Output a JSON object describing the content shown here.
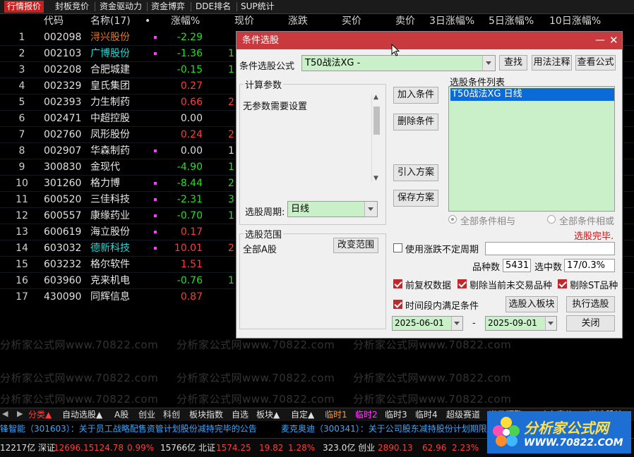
{
  "top_tabs": [
    "行情报价",
    "封板竞价",
    "资金驱动力",
    "资金博弈",
    "DDE排名",
    "SUP统计"
  ],
  "columns": [
    "代码",
    "名称(17)",
    "•",
    "涨幅%",
    "现价",
    "涨跌",
    "买价",
    "卖价",
    "3日涨幅%",
    "5日涨幅%",
    "10日涨幅%"
  ],
  "rows": [
    {
      "idx": "1",
      "code": "002098",
      "name": "浔兴股份",
      "chg": "-2.29",
      "name_color": "#e07a2a",
      "chg_color": "#22e022",
      "dot": true,
      "px": "",
      "px_color": "#22e022"
    },
    {
      "idx": "2",
      "code": "002103",
      "name": "广博股份",
      "chg": "-1.36",
      "name_color": "#28d8d8",
      "chg_color": "#22e022",
      "dot": true,
      "px": "1",
      "px_color": "#22e022"
    },
    {
      "idx": "3",
      "code": "002208",
      "name": "合肥城建",
      "chg": "-0.15",
      "name_color": "#e6e6e6",
      "chg_color": "#22e022",
      "dot": false,
      "px": "1",
      "px_color": "#22e022"
    },
    {
      "idx": "4",
      "code": "002329",
      "name": "皇氏集团",
      "chg": "0.27",
      "name_color": "#e6e6e6",
      "chg_color": "#ff3b3b",
      "dot": false,
      "px": "",
      "px_color": "#ff3b3b"
    },
    {
      "idx": "5",
      "code": "002393",
      "name": "力生制药",
      "chg": "0.66",
      "name_color": "#e6e6e6",
      "chg_color": "#ff3b3b",
      "dot": false,
      "px": "2",
      "px_color": "#ff3b3b"
    },
    {
      "idx": "6",
      "code": "002471",
      "name": "中超控股",
      "chg": "0.00",
      "name_color": "#e6e6e6",
      "chg_color": "#dddddd",
      "dot": false,
      "px": "",
      "px_color": "#dddddd"
    },
    {
      "idx": "7",
      "code": "002760",
      "name": "凤形股份",
      "chg": "0.24",
      "name_color": "#e6e6e6",
      "chg_color": "#ff3b3b",
      "dot": false,
      "px": "2",
      "px_color": "#ff3b3b"
    },
    {
      "idx": "8",
      "code": "002907",
      "name": "华森制药",
      "chg": "0.00",
      "name_color": "#e6e6e6",
      "chg_color": "#dddddd",
      "dot": true,
      "px": "1",
      "px_color": "#dddddd"
    },
    {
      "idx": "9",
      "code": "300830",
      "name": "金现代",
      "chg": "-4.90",
      "name_color": "#e6e6e6",
      "chg_color": "#22e022",
      "dot": false,
      "px": "1",
      "px_color": "#22e022"
    },
    {
      "idx": "10",
      "code": "301260",
      "name": "格力博",
      "chg": "-8.44",
      "name_color": "#e6e6e6",
      "chg_color": "#22e022",
      "dot": true,
      "px": "2",
      "px_color": "#22e022"
    },
    {
      "idx": "11",
      "code": "600520",
      "name": "三佳科技",
      "chg": "-2.31",
      "name_color": "#e6e6e6",
      "chg_color": "#22e022",
      "dot": true,
      "px": "3",
      "px_color": "#22e022"
    },
    {
      "idx": "12",
      "code": "600557",
      "name": "康缘药业",
      "chg": "-0.70",
      "name_color": "#e6e6e6",
      "chg_color": "#22e022",
      "dot": true,
      "px": "1",
      "px_color": "#22e022"
    },
    {
      "idx": "13",
      "code": "600619",
      "name": "海立股份",
      "chg": "0.17",
      "name_color": "#e6e6e6",
      "chg_color": "#ff3b3b",
      "dot": true,
      "px": "",
      "px_color": "#ff3b3b"
    },
    {
      "idx": "14",
      "code": "603032",
      "name": "德新科技",
      "chg": "10.01",
      "name_color": "#28d8d8",
      "chg_color": "#ff3b3b",
      "dot": true,
      "px": "2",
      "px_color": "#ff3b3b"
    },
    {
      "idx": "15",
      "code": "603232",
      "name": "格尔软件",
      "chg": "1.51",
      "name_color": "#e6e6e6",
      "chg_color": "#ff3b3b",
      "dot": false,
      "px": "",
      "px_color": "#ff3b3b"
    },
    {
      "idx": "16",
      "code": "603960",
      "name": "克来机电",
      "chg": "-0.76",
      "name_color": "#e6e6e6",
      "chg_color": "#22e022",
      "dot": false,
      "px": "1",
      "px_color": "#22e022"
    },
    {
      "idx": "17",
      "code": "430090",
      "name": "同辉信息",
      "chg": "0.87",
      "name_color": "#e6e6e6",
      "chg_color": "#ff3b3b",
      "dot": false,
      "px": "",
      "px_color": "#ff3b3b"
    }
  ],
  "watermark": "分析家公式网www.70822.com",
  "dialog": {
    "title": "条件选股",
    "formula_label": "条件选股公式",
    "formula_value": "T50战法XG  -",
    "btn_find": "查找",
    "btn_usage": "用法注释",
    "btn_view": "查看公式",
    "params_title": "计算参数",
    "params_text": "无参数需要设置",
    "btn_add": "加入条件",
    "btn_del": "删除条件",
    "btn_import": "引入方案",
    "btn_save": "保存方案",
    "cond_list_title": "选股条件列表",
    "cond_items": [
      "T50战法XG  日线"
    ],
    "radio_and": "全部条件相与",
    "radio_or": "全部条件相或",
    "status": "选股完毕.",
    "period_label": "选股周期:",
    "period_value": "日线",
    "range_title": "选股范围",
    "range_value": "全部A股",
    "btn_change_range": "改变范围",
    "use_period_label": "使用涨跌不定周期",
    "count_label": "品种数",
    "count_value": "5431",
    "selected_label": "选中数",
    "selected_value": "17/0.3%",
    "chk_fq": "前复权数据",
    "chk_notrade": "剔除当前未交易品种",
    "chk_st": "剔除ST品种",
    "chk_inrange": "时间段内满足条件",
    "btn_to_block": "选股入板块",
    "btn_execute": "执行选股",
    "date_from": "2025-06-01",
    "date_sep": "-",
    "date_to": "2025-09-01",
    "btn_close": "关闭"
  },
  "bottom_tabs": [
    "分类▲",
    "自动选股▲",
    "A股",
    "创业",
    "科创",
    "板块指数",
    "自选",
    "板块▲",
    "自定▲",
    "临时1",
    "临时2",
    "临时3",
    "临时4",
    "超级赛道",
    "当日预警",
    "一叶舟竞价",
    "一键选股结"
  ],
  "ticker": {
    "left": "锋智能（301603）：关于员工战略配售资管计划股份减持完毕的公告",
    "right": "麦克奥迪（300341）：关于公司股东减持股份计划期限"
  },
  "status_bar": {
    "s1": "12217亿 深证",
    "s2": "12696.15",
    "s3": "124.78",
    "s4": "0.99%",
    "s5": "15766亿 北证",
    "s6": "1574.25",
    "s7": "19.82",
    "s8": "1.28%",
    "s9": "323.0亿 创业",
    "s10": "2890.13",
    "s11": "62.96",
    "s12": "2.23%"
  },
  "logo": {
    "line1": "分析家公式网",
    "line2": "WWW.70822.COM"
  },
  "colors": {
    "up": "#ff3b3b",
    "down": "#22e022",
    "accent": "#c93a3f",
    "listbg": "#c9f0c9"
  }
}
